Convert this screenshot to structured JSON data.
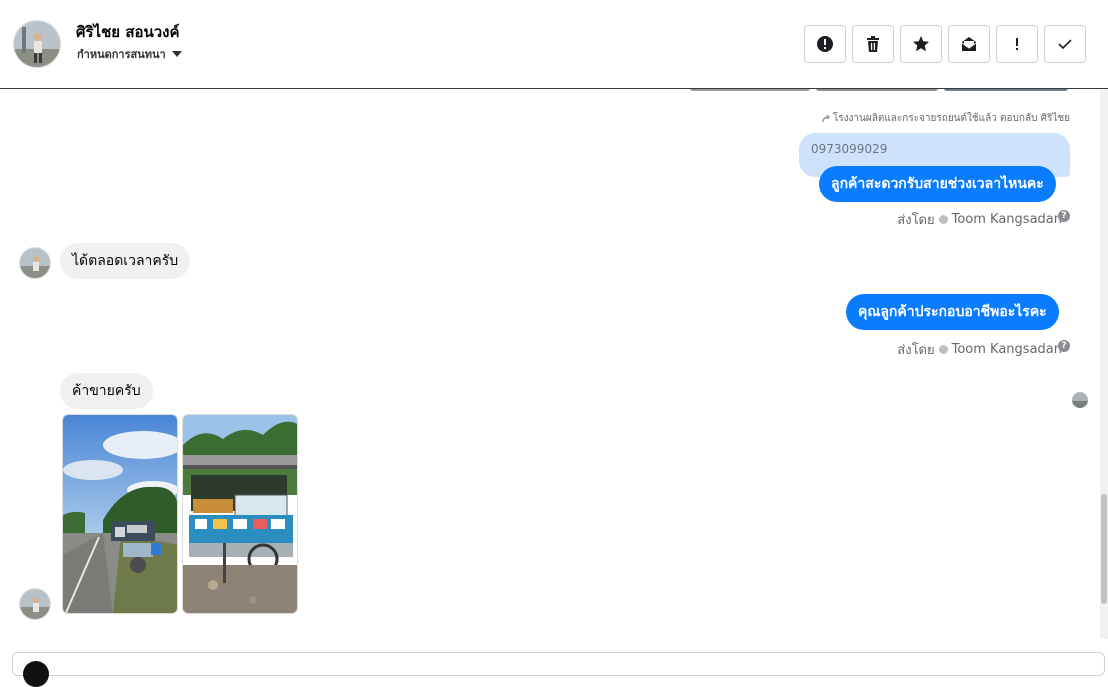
{
  "header": {
    "contact_name": "ศิริไชย สอนวงค์",
    "conversation_settings": "กำหนดการสนทนา",
    "actions": [
      {
        "name": "spam-button",
        "icon": "alert-circle-icon"
      },
      {
        "name": "delete-button",
        "icon": "trash-icon"
      },
      {
        "name": "star-button",
        "icon": "star-icon"
      },
      {
        "name": "mark-unread-button",
        "icon": "envelope-icon"
      },
      {
        "name": "important-button",
        "icon": "exclamation-icon"
      },
      {
        "name": "done-button",
        "icon": "check-icon"
      }
    ]
  },
  "thread": {
    "reply_label": "โรงงานผลิตและกระจายรถยนต์ใช้แล้ว ตอบกลับ ศิริไชย",
    "quoted_text": "0973099029",
    "messages": [
      {
        "direction": "out",
        "text": "ลูกค้าสะดวกรับสายช่วงเวลาไหนคะ"
      },
      {
        "direction": "in",
        "text": "ได้ตลอดเวลาครับ"
      },
      {
        "direction": "out",
        "text": "คุณลูกค้าประกอบอาชีพอะไรคะ"
      },
      {
        "direction": "in",
        "text": "ค้าขายครับ"
      }
    ],
    "sent_by_prefix": "ส่งโดย",
    "sent_by_name": "Toom Kangsadan",
    "help_glyph": "?"
  },
  "colors": {
    "outgoing_bubble": "#0a7cff",
    "incoming_bubble": "#f0f0f0",
    "quoted_bubble": "#cfe2fb"
  }
}
